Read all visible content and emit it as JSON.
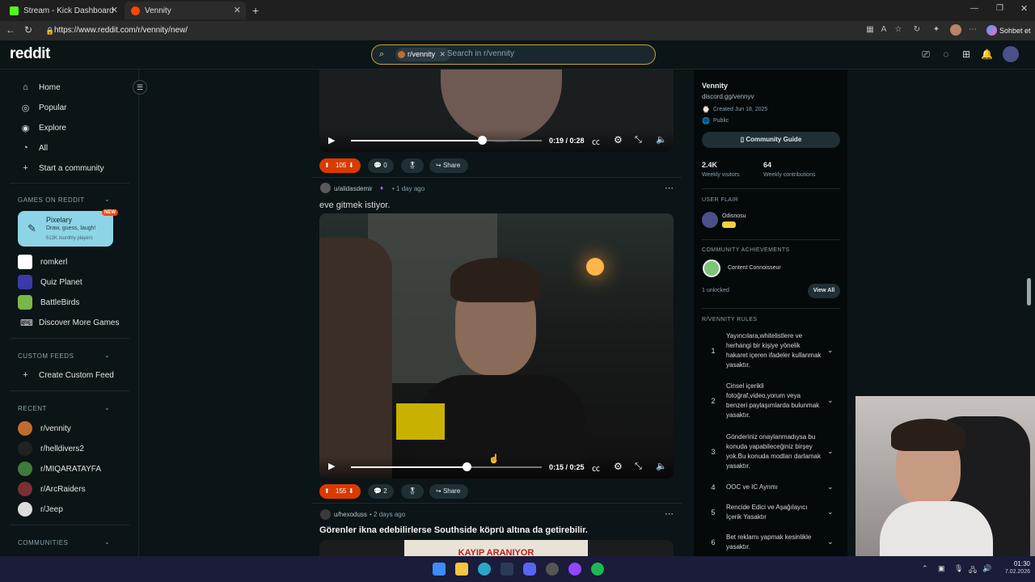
{
  "browser": {
    "tabs": [
      {
        "label": "Stream - Kick Dashboard",
        "active": false
      },
      {
        "label": "Vennity",
        "active": true
      }
    ],
    "url": "https://www.reddit.com/r/vennity/new/",
    "profile_button": "Sohbet et"
  },
  "header": {
    "logo": "reddit",
    "search_chip": "r/vennity",
    "search_placeholder": "Search in r/vennity"
  },
  "sidebar": {
    "nav": [
      "Home",
      "Popular",
      "Explore",
      "All",
      "Start a community"
    ],
    "games_header": "GAMES ON REDDIT",
    "featured_game": {
      "title": "Pixelary",
      "subtitle": "Draw, guess, laugh!",
      "players": "513K monthly players",
      "badge": "NEW"
    },
    "games": [
      "romkerl",
      "Quiz Planet",
      "BattleBirds",
      "Discover More Games"
    ],
    "custom_feeds_header": "CUSTOM FEEDS",
    "create_feed": "Create Custom Feed",
    "recent_header": "RECENT",
    "recent": [
      "r/vennity",
      "r/helldivers2",
      "r/MIQARATAYFA",
      "r/ArcRaiders",
      "r/Jeep"
    ],
    "communities_header": "COMMUNITIES"
  },
  "posts": [
    {
      "video_time": "0:19 / 0:28",
      "progress": 0.688,
      "votes": "105",
      "comments": "0",
      "share": "Share"
    },
    {
      "author": "u/alidasdemir",
      "age": "• 1 day ago",
      "title": "eve gitmek istiyor.",
      "video_time": "0:15 / 0:25",
      "progress": 0.605,
      "votes": "155",
      "comments": "2",
      "share": "Share"
    },
    {
      "author": "u/hexoduss",
      "age": "• 2 days ago",
      "title": "Görenler ikna edebilirlerse Southside köprü altına da getirebilir.",
      "thumb_text": "KAYIP ARANIYOR"
    }
  ],
  "about": {
    "name": "Vennity",
    "link": "discord.gg/vennyv",
    "created": "Created Jun 18, 2025",
    "visibility": "Public",
    "guide_button": "Community Guide",
    "stats": [
      {
        "value": "2.4K",
        "label": "Weekly visitors"
      },
      {
        "value": "64",
        "label": "Weekly contributions"
      }
    ],
    "user_flair_header": "USER FLAIR",
    "user_flair_name": "Odisnosu",
    "achievements_header": "COMMUNITY ACHIEVEMENTS",
    "achievement": "Content Connoisseur",
    "unlocked": "1 unlocked",
    "view_all": "View All",
    "rules_header": "R/VENNITY RULES",
    "rules": [
      {
        "n": "1",
        "text": "Yayıncılara,whitelistlere ve herhangi bir kişiye yönelik hakaret içeren ifadeler kullanmak yasaktır."
      },
      {
        "n": "2",
        "text": "Cinsel içerikli fotoğraf,video,yorum veya benzeri paylaşımlarda bulunmak yasaktır."
      },
      {
        "n": "3",
        "text": "Gönderiniz onaylanmadıysa bu konuda yapabileceğiniz birşey yok.Bu konuda modları darlamak yasaktır."
      },
      {
        "n": "4",
        "text": "OOC ve IC Ayrımı"
      },
      {
        "n": "5",
        "text": "Rencide Edici ve Aşağılayıcı İçerik Yasaktır"
      },
      {
        "n": "6",
        "text": "Bet reklamı yapmak kesinlikle yasaktır."
      }
    ]
  },
  "taskbar": {
    "time": "01:30",
    "date": "7.02.2026"
  },
  "colors": {
    "accent": "#ff4500",
    "bg": "#0b1416",
    "search_border": "#c9a22a"
  }
}
